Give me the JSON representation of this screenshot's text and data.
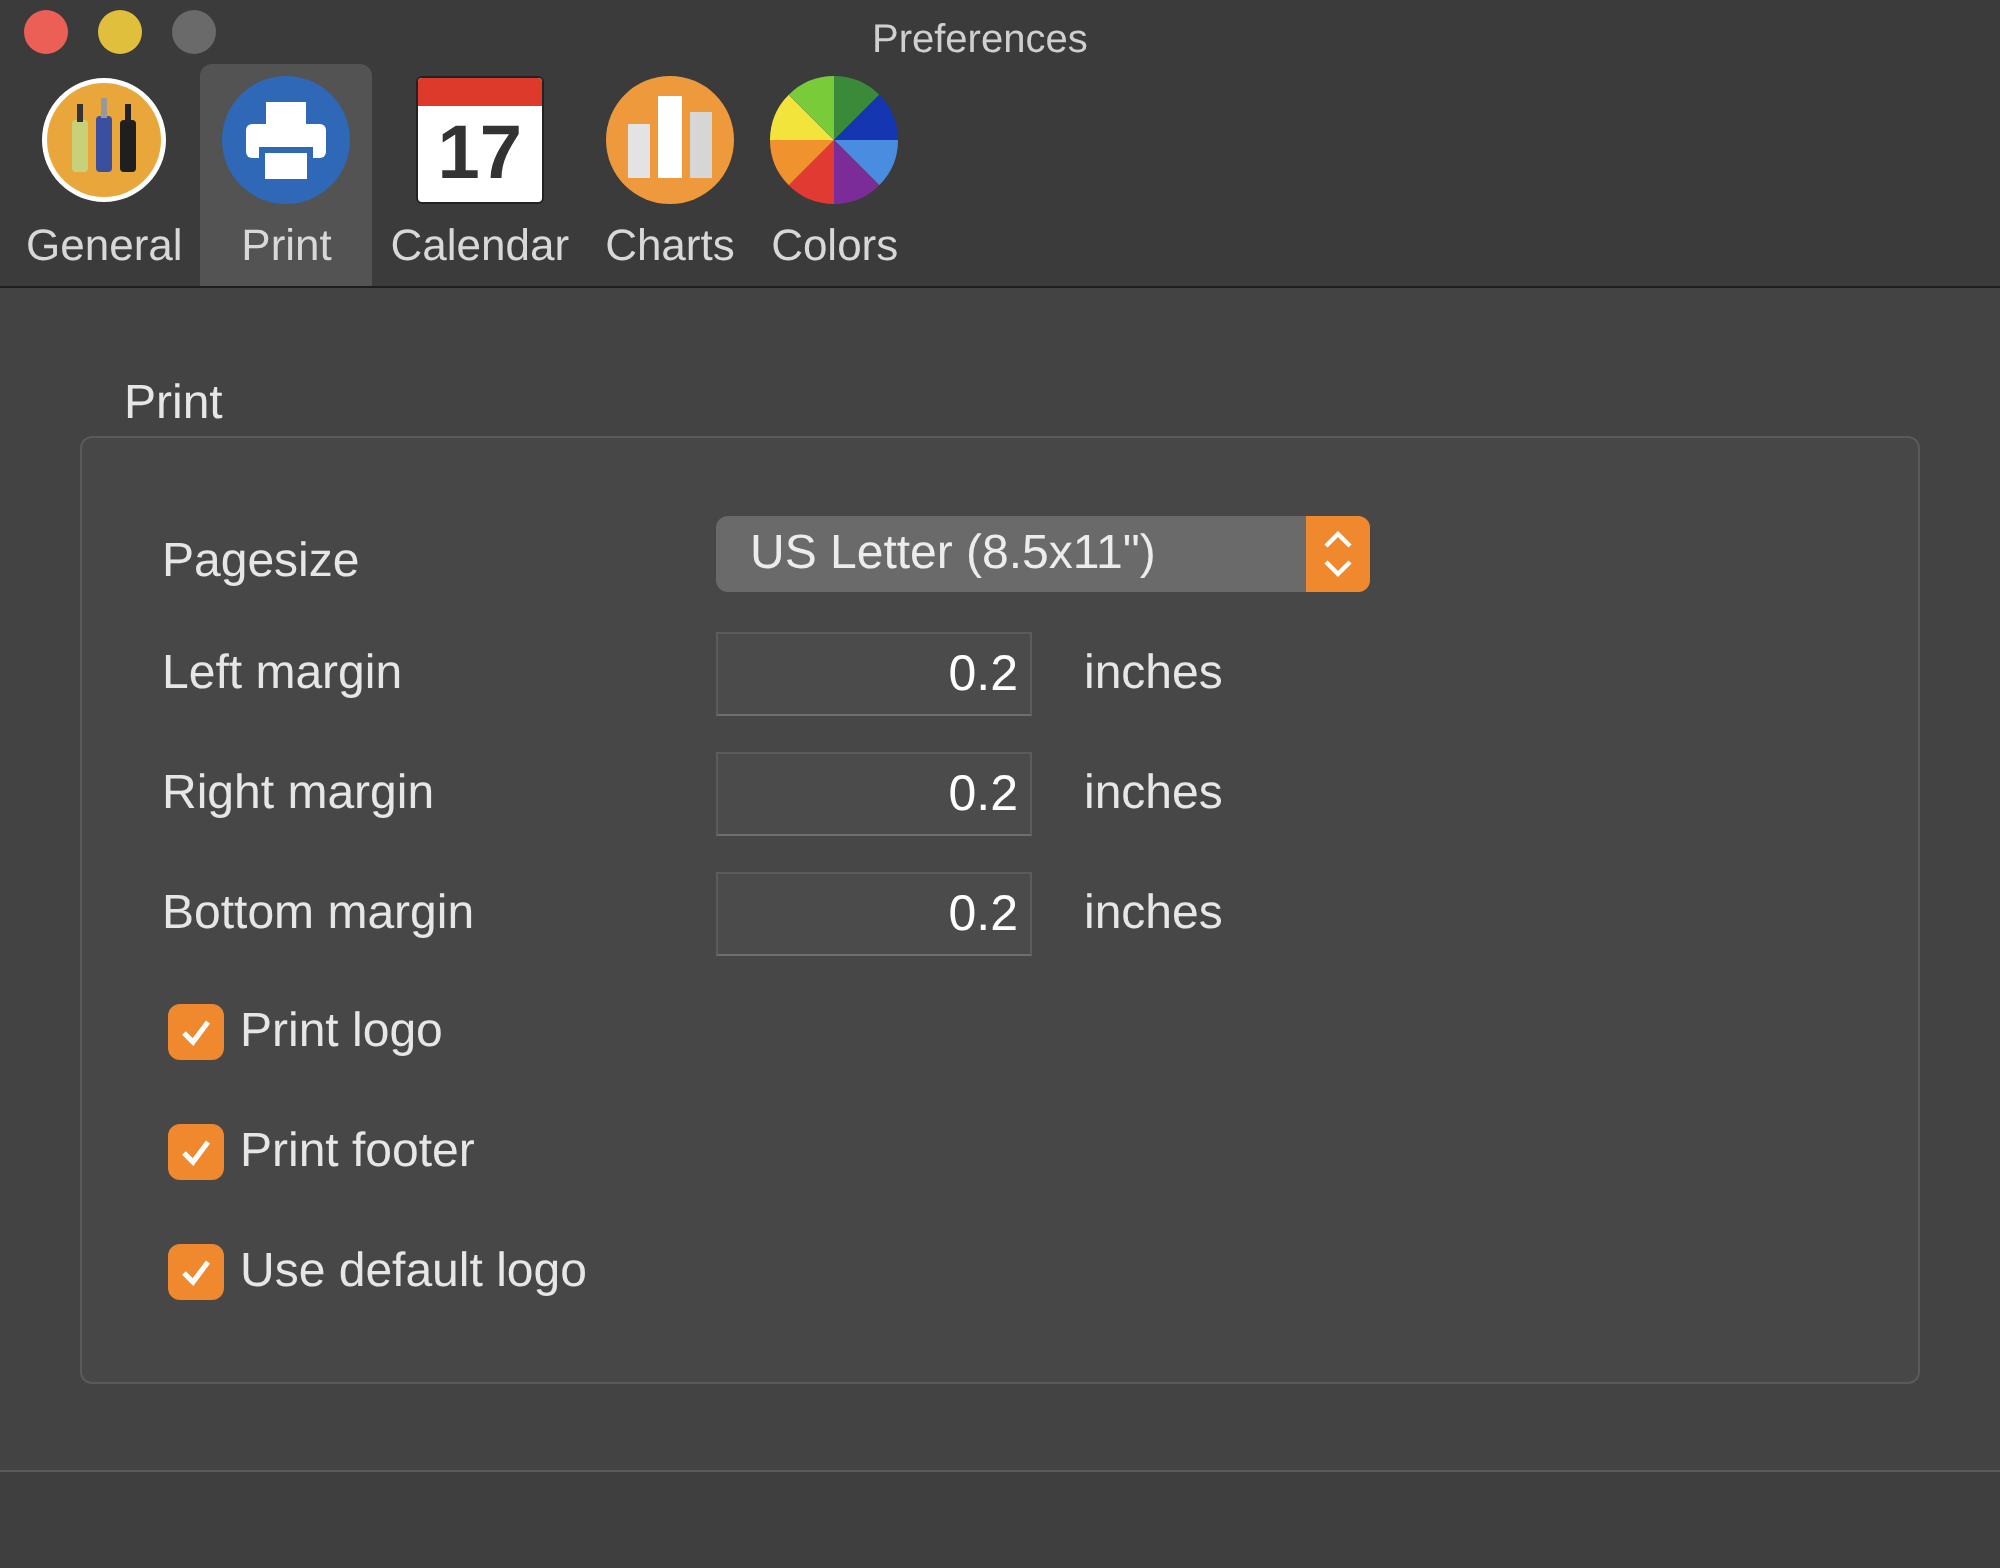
{
  "window": {
    "title": "Preferences"
  },
  "tabs": [
    {
      "kind": "general",
      "label": "General",
      "selected": false
    },
    {
      "kind": "print",
      "label": "Print",
      "selected": true
    },
    {
      "kind": "calendar",
      "label": "Calendar",
      "selected": false,
      "icon_text": "17"
    },
    {
      "kind": "charts",
      "label": "Charts",
      "selected": false
    },
    {
      "kind": "colors",
      "label": "Colors",
      "selected": false
    }
  ],
  "group": {
    "title": "Print",
    "pagesize": {
      "label": "Pagesize",
      "value": "US Letter (8.5x11\")"
    },
    "fields": [
      {
        "label": "Left margin",
        "value": "0.2",
        "unit": "inches"
      },
      {
        "label": "Right margin",
        "value": "0.2",
        "unit": "inches"
      },
      {
        "label": "Bottom margin",
        "value": "0.2",
        "unit": "inches"
      }
    ],
    "checkboxes": [
      {
        "label": "Print logo",
        "checked": true
      },
      {
        "label": "Print footer",
        "checked": true
      },
      {
        "label": "Use default logo",
        "checked": true
      }
    ]
  }
}
